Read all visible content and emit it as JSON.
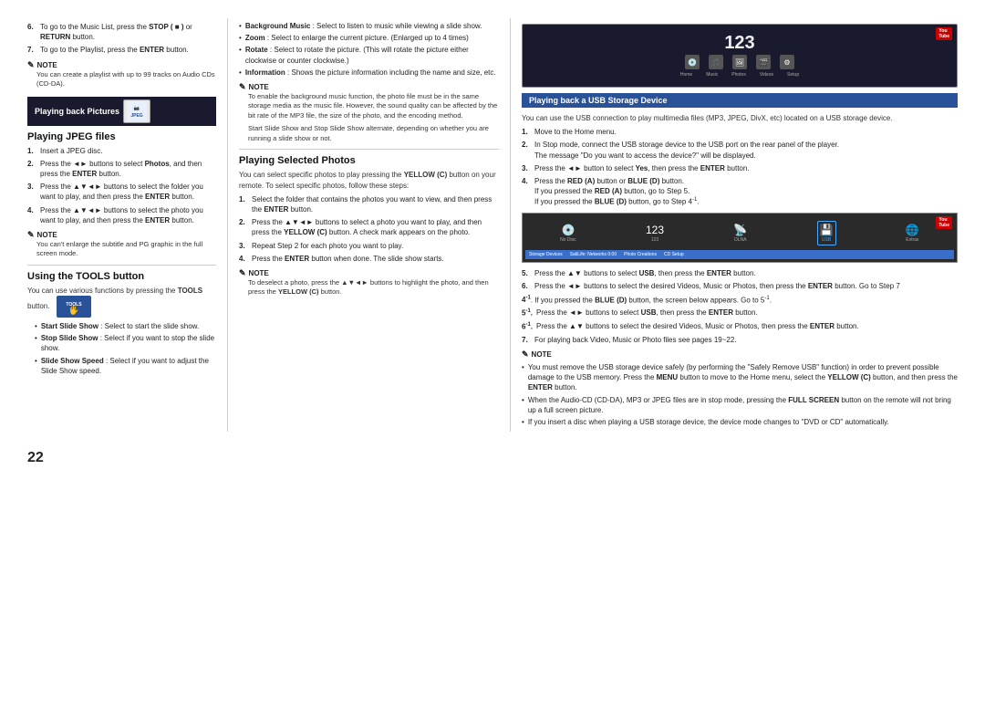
{
  "page": {
    "number": "22"
  },
  "col_left": {
    "pre_section": {
      "item6_text": "To go to the Music List, press the ",
      "item6_bold1": "STOP",
      "item6_stop_symbol": "( ■ )",
      "item6_bold2": " or ",
      "item6_bold3": "RETURN",
      "item6_rest": " button.",
      "item7_text": "To go to the Playlist, press the ",
      "item7_bold": "ENTER",
      "item7_rest": " button.",
      "note_label": "NOTE",
      "note_text": "You can create a playlist with up to 99 tracks on Audio CDs (CD-DA)."
    },
    "section": {
      "header": "Playing back Pictures",
      "icon_label": "JPEG"
    },
    "playing_jpeg": {
      "title": "Playing JPEG files",
      "steps": [
        {
          "num": "1.",
          "text": "Insert a JPEG disc."
        },
        {
          "num": "2.",
          "text": "Press the ◄► buttons to select ",
          "bold": "Photos",
          "rest": ", and then press the ",
          "bold2": "ENTER",
          "rest2": " button."
        },
        {
          "num": "3.",
          "text": "Press the ▲▼◄► buttons to select the folder you want to play, and then press the ",
          "bold": "ENTER",
          "rest": " button."
        },
        {
          "num": "4.",
          "text": "Press the ▲▼◄► buttons to select the photo you want to play, and then press the ",
          "bold": "ENTER",
          "rest": " button."
        }
      ],
      "note_label": "NOTE",
      "note_text": "You can't enlarge the subtitle and PG graphic in the full screen mode."
    },
    "tools_section": {
      "title": "Using the TOOLS button",
      "tools_badge": "TOOLS",
      "intro": "You can use various functions by pressing the ",
      "intro_bold": "TOOLS",
      "intro_rest": " button.",
      "bullets": [
        {
          "bold": "Start Slide Show",
          "text": " : Select to start the slide show."
        },
        {
          "bold": "Stop Slide Show",
          "text": " : Select if you want to stop the slide show."
        },
        {
          "bold": "Slide Show Speed",
          "text": " : Select if you want to adjust the Slide Show speed."
        }
      ]
    }
  },
  "col_mid": {
    "bullets": [
      {
        "bold": "Background Music",
        "text": " : Select to listen to music while viewing a slide show."
      },
      {
        "bold": "Zoom",
        "text": " : Select to enlarge the current picture. (Enlarged up to 4 times)"
      },
      {
        "bold": "Rotate",
        "text": " : Select to rotate the picture. (This will rotate the picture either clockwise or counter clockwise.)"
      },
      {
        "bold": "Information",
        "text": " : Shows the picture information including the name and size, etc."
      }
    ],
    "note_label": "NOTE",
    "note_text": "To enable the background music function, the photo file must be in the same storage media as the music file. However, the sound quality can be affected by the bit rate of the MP3 file, the size of the photo, and the encoding method.",
    "note_text2": "Start Slide Show and Stop Slide Show alternate, depending on whether you are running a slide show or not.",
    "playing_selected": {
      "title": "Playing Selected Photos",
      "intro": "You can select specific photos to play pressing the ",
      "intro_bold": "YELLOW (C)",
      "intro_rest": " button on your remote. To select specific photos, follow these steps:",
      "steps": [
        {
          "num": "1.",
          "text": "Select the folder that contains the photos you want to view, and then press the ",
          "bold": "ENTER",
          "rest": " button."
        },
        {
          "num": "2.",
          "text": "Press the ▲▼◄► buttons to select a photo you want to play, and then press the ",
          "bold": "YELLOW (C)",
          "rest": " button. A check mark appears on the photo."
        },
        {
          "num": "3.",
          "text": "Repeat Step 2 for each photo you want to play."
        },
        {
          "num": "4.",
          "text": "Press the ",
          "bold": "ENTER",
          "rest": " button when done. The slide show starts."
        }
      ],
      "note_label": "NOTE",
      "note_text": "To deselect a photo, press the ▲▼◄► buttons to highlight the photo, and then press the ",
      "note_text_bold": "YELLOW (C)",
      "note_text_end": " button."
    }
  },
  "col_right": {
    "usb_section": {
      "header": "Playing back a USB Storage Device",
      "intro": "You can use the USB connection to play multimedia files (MP3, JPEG, DivX, etc) located on a USB storage device.",
      "steps": [
        {
          "num": "1.",
          "text": "Move to the Home menu."
        },
        {
          "num": "2.",
          "text": "In Stop mode, connect the USB storage device to the USB port on the rear panel of the player.\nThe message \"Do you want to access the device?\" will be displayed."
        },
        {
          "num": "3.",
          "text": "Press the ◄► button to select ",
          "bold": "Yes",
          "rest": ", then press the ",
          "bold2": "ENTER",
          "rest2": " button."
        },
        {
          "num": "4.",
          "text": "Press the ",
          "bold": "RED (A)",
          "rest": " button or ",
          "bold2": "BLUE (D)",
          "rest2": " button.\nIf you pressed the ",
          "bold3": "RED (A)",
          "rest3": " button, go to Step 5.\nIf you pressed the ",
          "bold4": "BLUE (D)",
          "rest4": " button, go to Step 4",
          "super": "‐1",
          "rest5": "."
        }
      ],
      "screen1_note": "YouTube logo, 123, icons",
      "steps5": [
        {
          "num": "5",
          "sup": "-1",
          "text": "Press the ◄► buttons to select ",
          "bold": "USB",
          "rest": ", then press the ",
          "bold2": "ENTER",
          "rest2": " button."
        },
        {
          "num": "6",
          "sup": "-1",
          "text": "Press the ▲▼ buttons to select the desired Videos, Music or Photos, then press the ",
          "bold": "ENTER",
          "rest": " button."
        },
        {
          "num": "7.",
          "text": "For playing back Video, Music or Photo files see pages 19~22."
        }
      ],
      "note_label": "NOTE",
      "note_bullets": [
        "You must remove the USB storage device safely (by performing the \"Safely Remove USB\" function) in order to prevent possible damage to the USB memory. Press the MENU button to move to the Home menu, select the YELLOW (C) button, and then press the ENTER button.",
        "When the Audio-CD (CD-DA), MP3 or JPEG files are in stop mode, pressing the FULL SCREEN button on the remote will not bring up a full screen picture.",
        "If you insert a disc when playing a USB storage device, the device mode changes to \"DVD or CD\" automatically."
      ]
    },
    "steps_mid": [
      {
        "num": "5.",
        "text": "Press the ▲▼ buttons to select ",
        "bold": "USB",
        "rest": ", then press the ",
        "bold2": "ENTER",
        "rest2": " button."
      },
      {
        "num": "6.",
        "text": "Press the ◄► buttons to select the desired Videos, Music or Photos, then press the ",
        "bold": "ENTER",
        "rest": " button. Go to Step 7"
      }
    ],
    "step_41": {
      "num": "4",
      "sup": "-1",
      "text": " If you pressed the ",
      "bold": "BLUE (D)",
      "rest": " button, the screen below appears. Go to 5",
      "sup2": "‐1",
      "rest2": "."
    }
  }
}
